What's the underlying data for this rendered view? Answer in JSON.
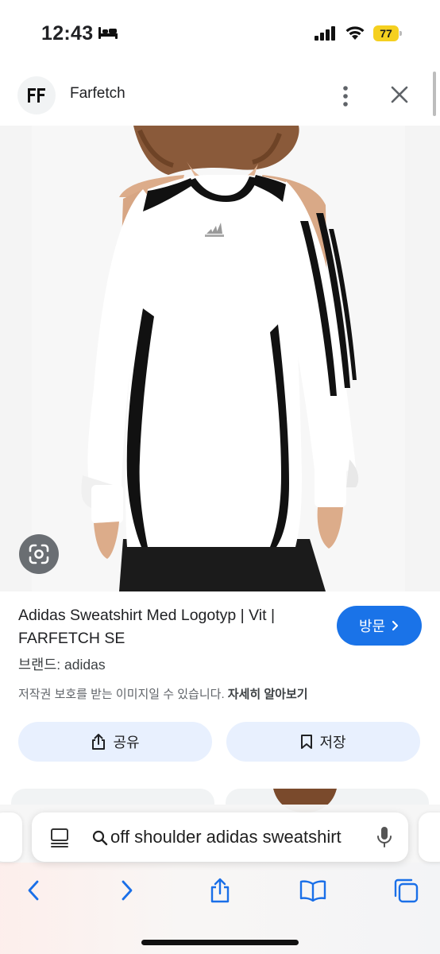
{
  "status_bar": {
    "time": "12:43",
    "battery": "77"
  },
  "source": {
    "name": "Farfetch",
    "logo_text": "FF"
  },
  "product": {
    "title": "Adidas Sweatshirt Med Logotyp | Vit | FARFETCH SE",
    "visit_label": "방문",
    "brand": "브랜드: adidas",
    "copyright_text": "저작권 보호를 받는 이미지일 수 있습니다.",
    "copyright_link": "자세히 알아보기"
  },
  "actions": {
    "share_label": "공유",
    "save_label": "저장"
  },
  "address_bar": {
    "query": "off shoulder adidas sweatshirt"
  },
  "icons": {
    "bed": "sleep-focus-icon",
    "lens": "google-lens-icon",
    "share": "share-icon",
    "bookmark": "bookmark-icon",
    "mic": "microphone-icon"
  },
  "colors": {
    "accent": "#1a73e8",
    "pill_bg": "#e8f0fe",
    "battery": "#f5d020"
  }
}
